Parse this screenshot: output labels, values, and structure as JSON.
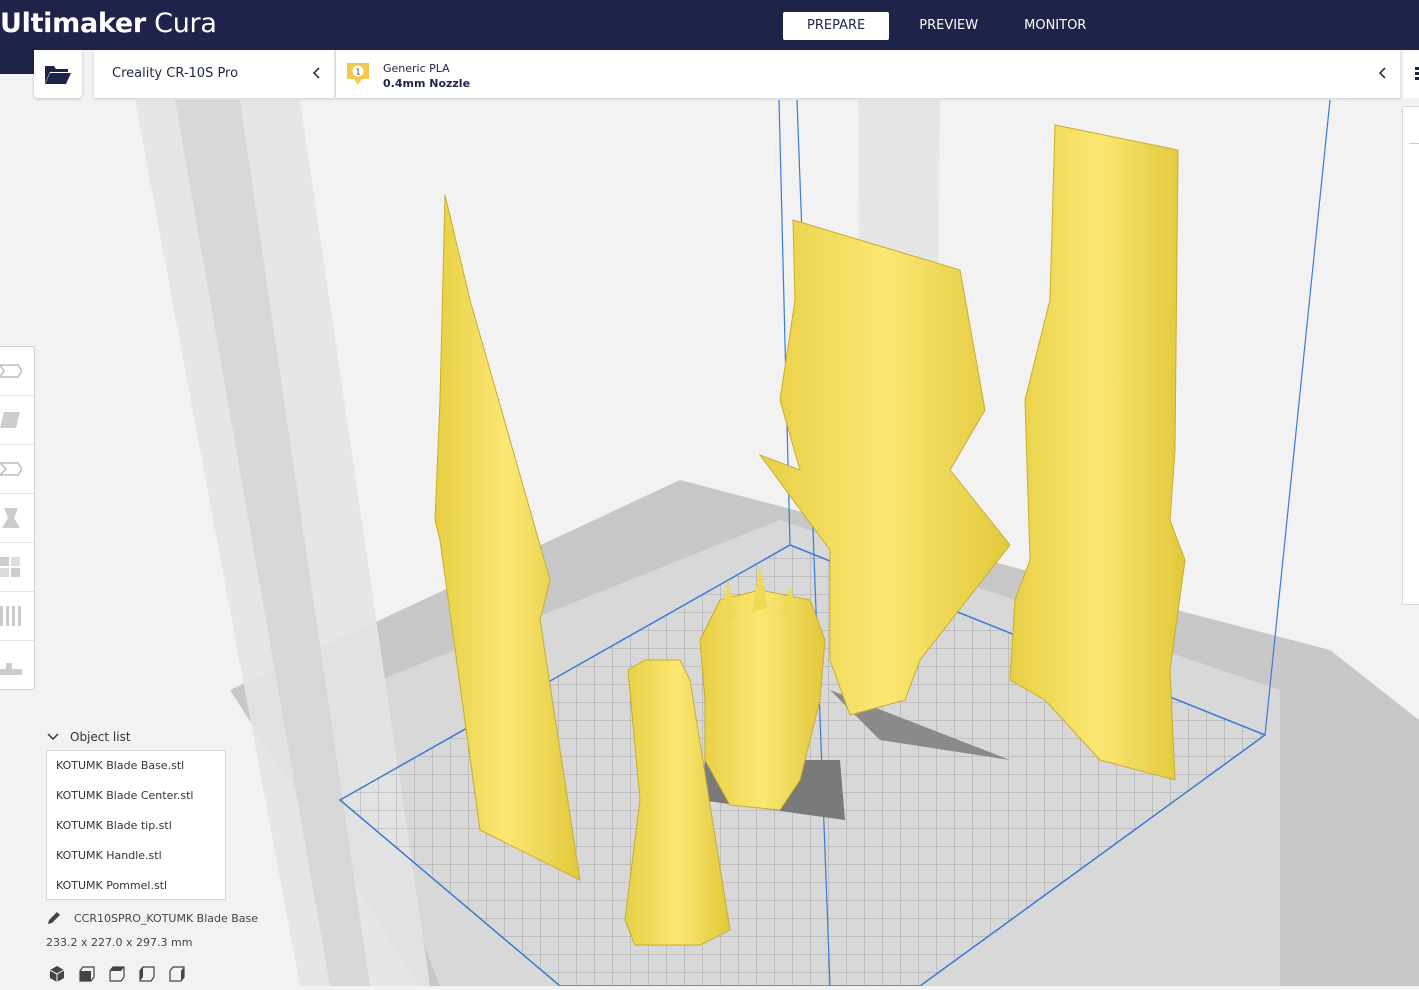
{
  "app": {
    "brand_bold": "Ultimaker",
    "brand_light": "Cura"
  },
  "stages": [
    {
      "label": "PREPARE",
      "active": true
    },
    {
      "label": "PREVIEW",
      "active": false
    },
    {
      "label": "MONITOR",
      "active": false
    }
  ],
  "printer": {
    "name": "Creality CR-10S Pro"
  },
  "material": {
    "extruder_number": "1",
    "name": "Generic PLA",
    "nozzle": "0.4mm Nozzle"
  },
  "tools": [
    "move-tool",
    "scale-tool",
    "rotate-tool",
    "mirror-tool",
    "per-model-settings-tool",
    "support-blocker-tool",
    "custom-supports-tool"
  ],
  "object_list": {
    "header": "Object list",
    "items": [
      "KOTUMK Blade Base.stl",
      "KOTUMK Blade Center.stl",
      "KOTUMK Blade tip.stl",
      "KOTUMK Handle.stl",
      "KOTUMK Pommel.stl"
    ]
  },
  "job": {
    "name": "CCR10SPRO_KOTUMK Blade Base",
    "dimensions": "233.2 x 227.0 x 297.3 mm"
  },
  "view_buttons": [
    "3d-view",
    "front-view",
    "top-view",
    "left-view",
    "right-view"
  ],
  "colors": {
    "header": "#1e2449",
    "model": "#f7e263",
    "build_plate_grid": "#3a7bd5"
  }
}
